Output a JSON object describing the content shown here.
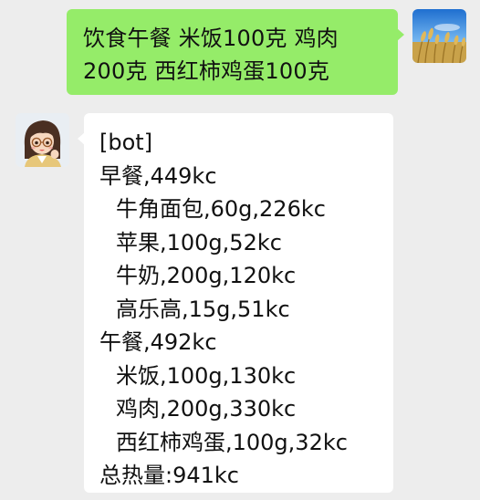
{
  "messages": {
    "user": {
      "avatar_icon": "wheat-field-avatar-icon",
      "lines": [
        "饮食午餐 米饭100克 鸡肉",
        "200克 西红柿鸡蛋100克"
      ]
    },
    "bot": {
      "avatar_icon": "cartoon-girl-avatar-icon",
      "lines": [
        "[bot]",
        "早餐,449kc",
        "牛角面包,60g,226kc",
        "苹果,100g,52kc",
        "牛奶,200g,120kc",
        "高乐高,15g,51kc",
        "午餐,492kc",
        "米饭,100g,130kc",
        "鸡肉,200g,330kc",
        "西红柿鸡蛋,100g,32kc",
        "总热量:941kc"
      ]
    }
  },
  "colors": {
    "background": "#ededed",
    "outgoing_bubble": "#95ec69",
    "incoming_bubble": "#ffffff",
    "text": "#111111"
  }
}
